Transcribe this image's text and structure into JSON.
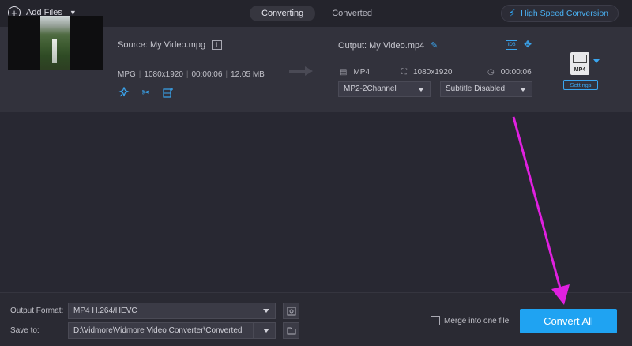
{
  "toolbar": {
    "add_files_label": "Add Files",
    "tabs": [
      {
        "label": "Converting",
        "active": true
      },
      {
        "label": "Converted",
        "active": false
      }
    ],
    "high_speed_label": "High Speed Conversion"
  },
  "file": {
    "source_label": "Source: My Video.mpg",
    "format": "MPG",
    "resolution": "1080x1920",
    "duration": "00:00:06",
    "size": "12.05 MB",
    "output_label": "Output: My Video.mp4",
    "output_format": "MP4",
    "output_resolution": "1080x1920",
    "output_duration": "00:00:06",
    "audio_select": "MP2-2Channel",
    "subtitle_select": "Subtitle Disabled",
    "format_icon_label": "MP4",
    "settings_label": "Settings",
    "id3_label": "ID3",
    "info_label": "i"
  },
  "bottom": {
    "output_format_label": "Output Format:",
    "output_format_value": "MP4 H.264/HEVC",
    "save_to_label": "Save to:",
    "save_to_value": "D:\\Vidmore\\Vidmore Video Converter\\Converted",
    "merge_label": "Merge into one file",
    "merge_checked": false,
    "convert_all_label": "Convert All"
  },
  "colors": {
    "accent": "#1fa3f2",
    "annotation": "#e020e0"
  }
}
